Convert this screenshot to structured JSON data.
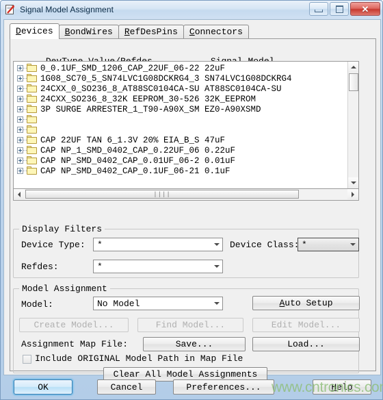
{
  "window": {
    "title": "Signal Model Assignment",
    "icon": "app-document-icon",
    "controls": {
      "minimize": "minimize-icon",
      "maximize": "maximize-icon",
      "close": "✕"
    }
  },
  "tabs": [
    {
      "label": "Devices",
      "mnemonic": "D",
      "rest": "evices",
      "active": true
    },
    {
      "label": "BondWires",
      "mnemonic": "B",
      "rest": "ondWires",
      "active": false
    },
    {
      "label": "RefDesPins",
      "mnemonic": "R",
      "rest": "efDesPins",
      "active": false
    },
    {
      "label": "Connectors",
      "mnemonic": "C",
      "rest": "onnectors",
      "active": false
    }
  ],
  "list": {
    "header_left": "DevType Value/Refdes",
    "header_right": "Signal Model",
    "rows": [
      {
        "devtype": "0_0.1UF_SMD_1206_CAP_22UF_06-22",
        "model": "22uF"
      },
      {
        "devtype": "1G08_SC70_5_SN74LVC1G08DCKRG4_3",
        "model": "SN74LVC1G08DCKRG4"
      },
      {
        "devtype": "24CXX_0_SO236_8_AT88SC0104CA-SU",
        "model": "AT88SC0104CA-SU"
      },
      {
        "devtype": "24CXX_SO236_8_32K EEPROM_30-526",
        "model": "32K_EEPROM"
      },
      {
        "devtype": "3P SURGE ARRESTER_1_T90-A90X_SM",
        "model": "EZ0-A90XSMD"
      },
      {
        "devtype": "",
        "model": ""
      },
      {
        "devtype": "",
        "model": ""
      },
      {
        "devtype": "CAP 22UF TAN 6_1.3V 20% EIA_B_S",
        "model": "47uF"
      },
      {
        "devtype": "CAP NP_1_SMD_0402_CAP_0.22UF_06",
        "model": "0.22uF"
      },
      {
        "devtype": "CAP NP_SMD_0402_CAP_0.01UF_06-2",
        "model": "0.01uF"
      },
      {
        "devtype": "CAP NP_SMD_0402_CAP_0.1UF_06-21",
        "model": "0.1uF"
      }
    ],
    "scroll": {
      "vertical_up": "scroll-up-icon",
      "vertical_down": "scroll-down-icon",
      "horizontal_left": "scroll-left-icon",
      "horizontal_right": "scroll-right-icon",
      "grip": "||||"
    }
  },
  "display_filters": {
    "title": "Display Filters",
    "device_type": {
      "label": "Device Type:",
      "value": "*"
    },
    "device_class": {
      "label": "Device Class:",
      "value": "*"
    },
    "refdes": {
      "label": "Refdes:",
      "value": "*"
    }
  },
  "model_assignment": {
    "title": "Model Assignment",
    "model": {
      "label": "Model:",
      "value": "No Model"
    },
    "auto_setup": {
      "label_mn": "A",
      "label_rest": "uto Setup"
    },
    "create_model": {
      "label": "Create Model...",
      "enabled": false
    },
    "find_model": {
      "label": "Find Model...",
      "enabled": false
    },
    "edit_model": {
      "label": "Edit Model...",
      "enabled": false
    },
    "map_file_label": "Assignment Map File:",
    "save": {
      "label": "Save..."
    },
    "load": {
      "label": "Load..."
    },
    "include_original": {
      "label": "Include ORIGINAL Model Path in Map File",
      "checked": false
    },
    "clear_all": {
      "label": "Clear All Model Assignments"
    }
  },
  "bottom": {
    "ok": "OK",
    "cancel": "Cancel",
    "preferences": "Preferences...",
    "help_mn": "H",
    "help_rest": "elp"
  },
  "watermark": "www.cntronics.com",
  "colors": {
    "window_frame": "#b3cde8",
    "client_bg": "#f0f0f0",
    "close_button": "#c7392f",
    "folder": "#fdf6b8",
    "ok_focus": "#3c7fb1",
    "watermark": "#8fbf7a"
  }
}
